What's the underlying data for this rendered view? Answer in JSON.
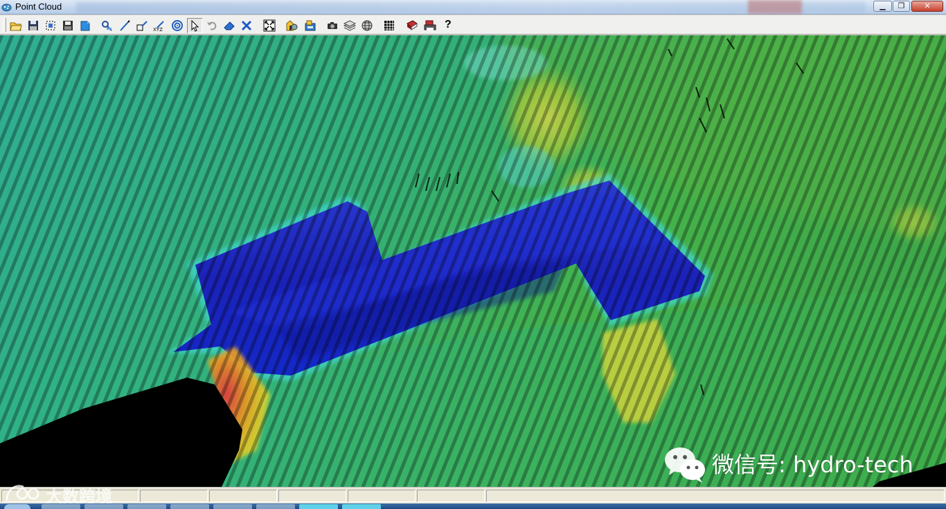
{
  "window": {
    "title": "Point Cloud",
    "controls": {
      "minimize": "▁",
      "maximize": "❐",
      "close": "✕"
    }
  },
  "toolbar": {
    "buttons": [
      {
        "name": "open-file",
        "icon": "open-folder-icon"
      },
      {
        "name": "save",
        "icon": "save-disk-icon"
      },
      {
        "name": "select-region",
        "icon": "select-region-icon"
      },
      {
        "name": "save-as",
        "icon": "save-as-icon"
      },
      {
        "name": "export",
        "icon": "export-icon"
      },
      {
        "name": "measure-tool",
        "icon": "measure-icon"
      },
      {
        "name": "draw-line",
        "icon": "pen-line-icon"
      },
      {
        "name": "draw-box",
        "icon": "pen-box-icon"
      },
      {
        "name": "xyz-coordinates",
        "icon": "xyz-icon"
      },
      {
        "name": "target",
        "icon": "target-icon"
      },
      {
        "name": "pointer",
        "icon": "pointer-arrow-icon",
        "selected": true
      },
      {
        "name": "undo",
        "icon": "undo-icon"
      },
      {
        "name": "eraser",
        "icon": "eraser-icon"
      },
      {
        "name": "delete",
        "icon": "delete-x-icon"
      },
      {
        "name": "zoom-extents",
        "icon": "fit-extents-icon"
      },
      {
        "name": "color-settings",
        "icon": "color-settings-icon"
      },
      {
        "name": "render-settings",
        "icon": "render-settings-icon"
      },
      {
        "name": "camera",
        "icon": "camera-icon"
      },
      {
        "name": "layers",
        "icon": "layers-icon"
      },
      {
        "name": "globe",
        "icon": "globe-icon"
      },
      {
        "name": "grid-view",
        "icon": "grid-view-icon"
      },
      {
        "name": "book",
        "icon": "book-icon"
      },
      {
        "name": "print",
        "icon": "print-icon"
      },
      {
        "name": "help",
        "icon": "help-icon",
        "label": "?"
      }
    ]
  },
  "viewport": {
    "content": "point-cloud-bathymetry",
    "colors": {
      "deep": "#1a22c8",
      "shallow": "#2fa7a0",
      "mid": "#3fb85a",
      "high": "#e9e230",
      "peak": "#d23a1a",
      "nodata": "#000000"
    }
  },
  "watermark": {
    "text": "微信号: hydro-tech"
  },
  "logo_watermark": {
    "text": "大数跨境"
  },
  "statusbar": {
    "panes": [
      "",
      "",
      "",
      "",
      "",
      "",
      ""
    ]
  }
}
